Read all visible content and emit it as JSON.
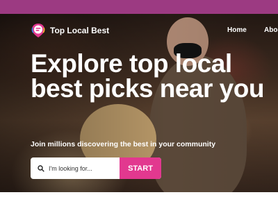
{
  "header": {
    "brand_name": "Top Local Best",
    "nav": {
      "home": "Home",
      "about": "Abo"
    }
  },
  "hero": {
    "headline": "Explore top local best picks near you",
    "subheadline": "Join millions discovering the best in your community",
    "search": {
      "placeholder": "I'm looking for...",
      "value": "",
      "button_label": "START"
    }
  },
  "colors": {
    "accent": "#e2388f",
    "topbar": "#9c3a82",
    "logo_pin": "#e2388f"
  },
  "icons": {
    "logo": "location-pin-chat-icon",
    "search": "search-icon"
  }
}
